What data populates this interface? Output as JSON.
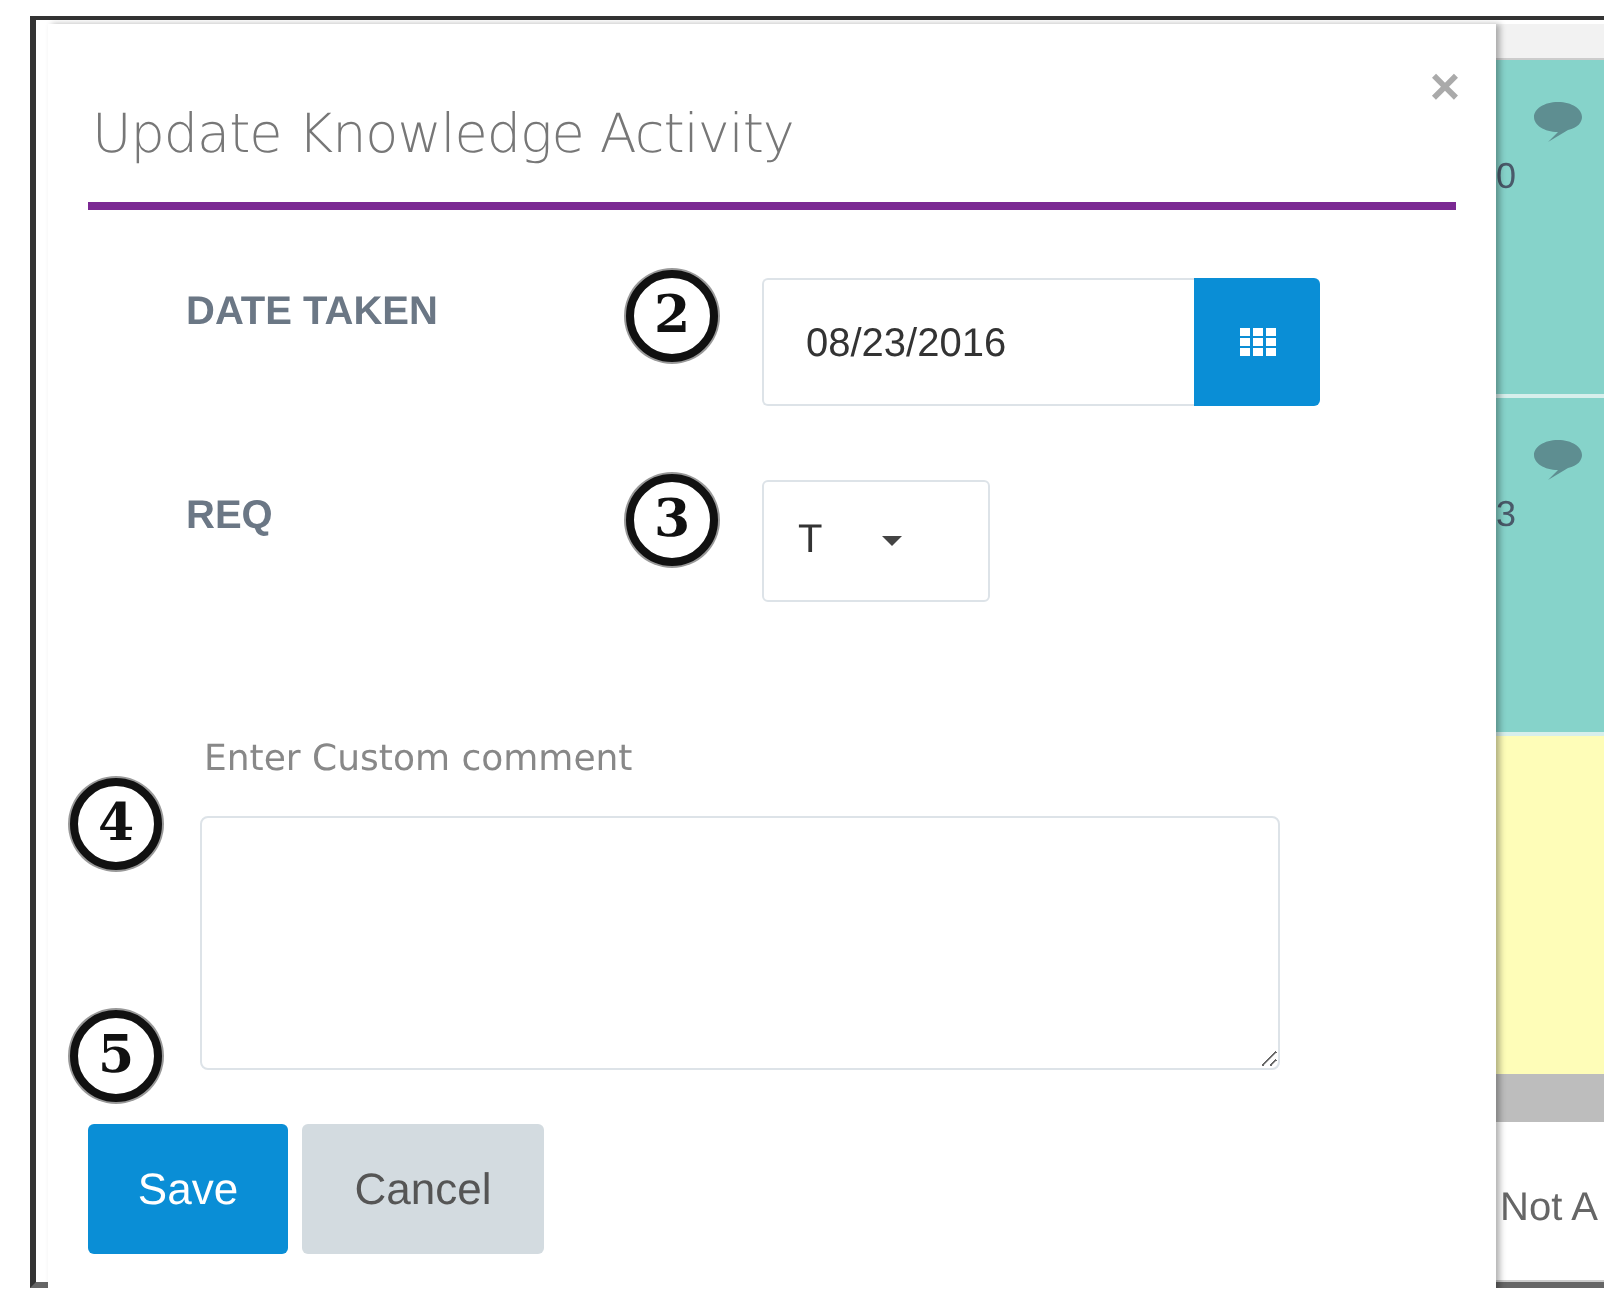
{
  "dialog": {
    "title": "Update Knowledge Activity",
    "close": "×"
  },
  "fields": [
    {
      "kind": "date",
      "label": "DATE TAKEN",
      "marker": "2",
      "value": "08/23/2016"
    },
    {
      "kind": "select",
      "label": "REQ",
      "marker": "3",
      "value": "T"
    }
  ],
  "comment": {
    "placeholder": "Enter Custom comment",
    "markers": [
      "4",
      "5"
    ]
  },
  "buttons": [
    {
      "label": "Save",
      "kind": "primary"
    },
    {
      "label": "Cancel",
      "kind": "secondary"
    }
  ],
  "background": {
    "rows": [
      {
        "kind": "header"
      },
      {
        "kind": "teal",
        "text": "0"
      },
      {
        "kind": "teal",
        "text": "3"
      },
      {
        "kind": "yellow"
      },
      {
        "kind": "grey"
      },
      {
        "kind": "plain",
        "text": "Not A"
      }
    ]
  }
}
